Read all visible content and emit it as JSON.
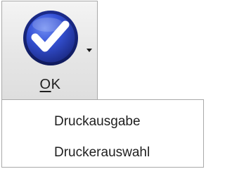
{
  "ok_button": {
    "icon": "checkmark-circle-icon",
    "label_mnemonic": "O",
    "label_rest": "K",
    "colors": {
      "icon_outer": "#1e2f8a",
      "icon_inner": "#3f5fe0",
      "check": "#ffffff"
    }
  },
  "dropdown": {
    "arrow_icon": "chevron-down-icon",
    "items": [
      {
        "label": "Druckausgabe"
      },
      {
        "label": "Druckerauswahl"
      }
    ]
  }
}
